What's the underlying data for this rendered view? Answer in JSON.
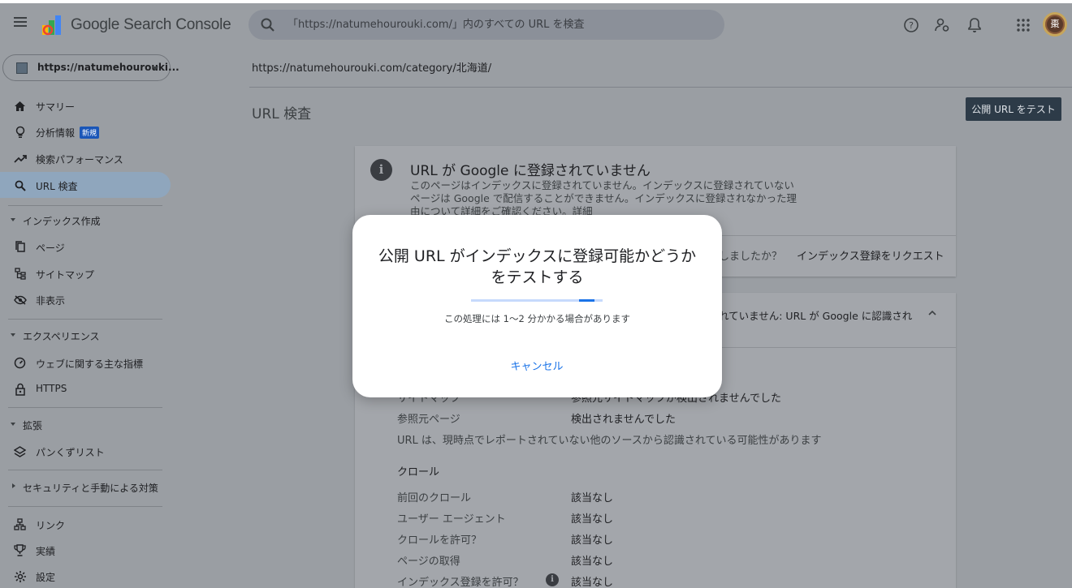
{
  "app": {
    "title": "Google Search Console"
  },
  "search": {
    "placeholder": "「https://natumehourouki.com/」内のすべての URL を検査"
  },
  "avatar": {
    "initial": "棗"
  },
  "property": {
    "label": "https://natumehourouki..."
  },
  "sidebar": {
    "items": [
      {
        "label": "サマリー",
        "icon": "home-icon"
      },
      {
        "label": "分析情報",
        "badge": "新規",
        "icon": "lightbulb-icon"
      },
      {
        "label": "検索パフォーマンス",
        "icon": "trending-icon"
      },
      {
        "label": "URL 検査",
        "icon": "search-icon",
        "active": true
      }
    ],
    "sections": {
      "index": {
        "label": "インデックス作成",
        "items": [
          "ページ",
          "サイトマップ",
          "非表示"
        ]
      },
      "experience": {
        "label": "エクスペリエンス",
        "items": [
          "ウェブに関する主な指標",
          "HTTPS"
        ]
      },
      "enhancements": {
        "label": "拡張",
        "items": [
          "パンくずリスト"
        ]
      },
      "security": {
        "label": "セキュリティと手動による対策"
      },
      "bottom": [
        "リンク",
        "実績",
        "設定"
      ]
    }
  },
  "main": {
    "url": "https://natumehourouki.com/category/北海道/",
    "page_title": "URL 検査",
    "test_live_button": "公開 URL をテスト",
    "status_card": {
      "title": "URL が Google に登録されていません",
      "description": "このページはインデックスに登録されていません。インデックスに登録されていないページは Google で配信することができません。インデックスに登録されなかった理由について詳細をご確認ください。詳細",
      "question": "しましたか？",
      "request_indexing": "インデックス登録をリクエスト"
    },
    "coverage_card": {
      "heading": "れていません: URL が Google に認識され",
      "sitemap_label": "サイトマップ",
      "sitemap_value": "参照元サイトマップが検出されませんでした",
      "referring_label": "参照元ページ",
      "referring_value": "検出されませんでした",
      "note": "URL は、現時点でレポートされていない他のソースから認識されている可能性があります",
      "crawl_heading": "クロール",
      "rows": [
        {
          "label": "前回のクロール",
          "value": "該当なし"
        },
        {
          "label": "ユーザー エージェント",
          "value": "該当なし"
        },
        {
          "label": "クロールを許可？",
          "value": "該当なし"
        },
        {
          "label": "ページの取得",
          "value": "該当なし"
        },
        {
          "label": "インデックス登録を許可？",
          "value": "該当なし"
        }
      ]
    }
  },
  "modal": {
    "title_line1": "公開 URL がインデックスに登録可能かどうか",
    "title_line2": "をテストする",
    "note": "この処理には 1〜2 分かかる場合があります",
    "cancel": "キャンセル",
    "progress": 0.12
  },
  "colors": {
    "accent": "#1a73e8",
    "active_nav": "#8fa6bd",
    "dark_button": "#2d3b48"
  }
}
